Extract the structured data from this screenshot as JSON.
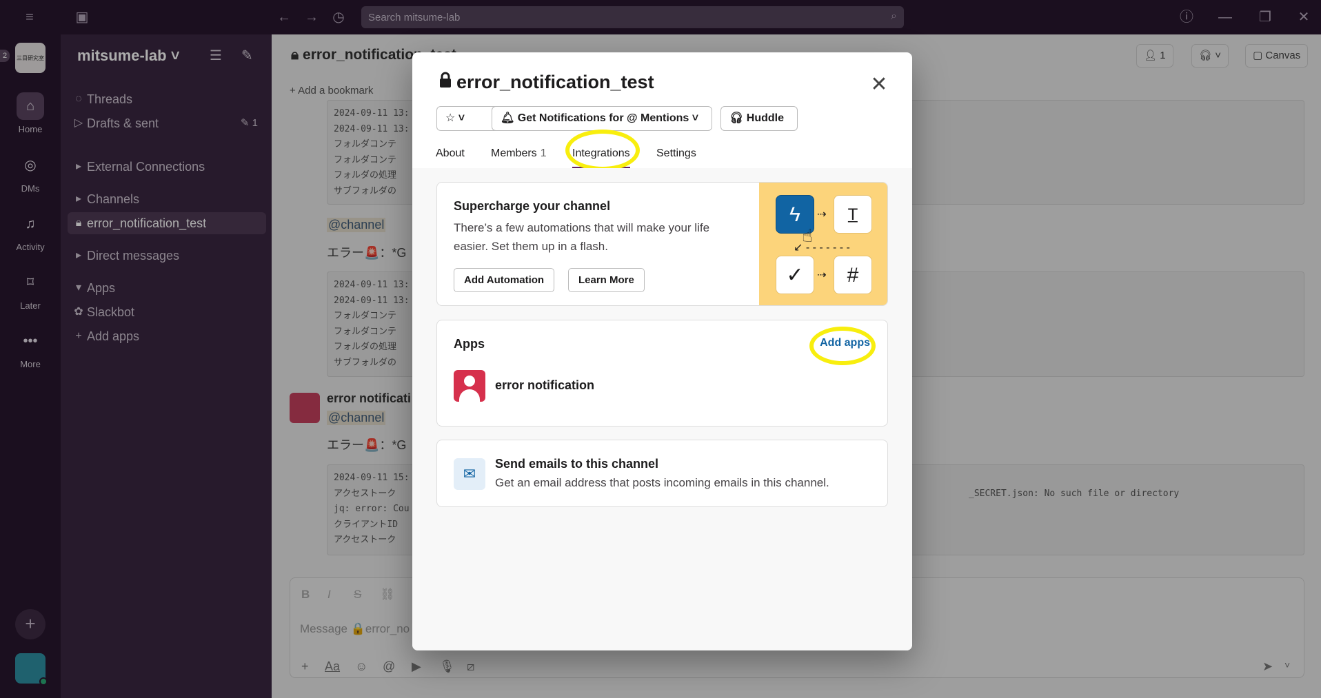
{
  "titlebar": {
    "search_placeholder": "Search mitsume-lab"
  },
  "rail": {
    "badge": "2",
    "workspace_logo_text": "三目研究室",
    "items": [
      {
        "label": "Home",
        "icon": "home-icon"
      },
      {
        "label": "DMs",
        "icon": "dm-icon"
      },
      {
        "label": "Activity",
        "icon": "bell-icon"
      },
      {
        "label": "Later",
        "icon": "bookmark-icon"
      },
      {
        "label": "More",
        "icon": "ellipsis-icon"
      }
    ]
  },
  "sidebar": {
    "workspace_name": "mitsume-lab",
    "threads": "Threads",
    "drafts": "Drafts & sent",
    "drafts_count": "1",
    "external": "External Connections",
    "channels": "Channels",
    "active_channel": "error_notification_test",
    "direct_messages": "Direct messages",
    "apps": "Apps",
    "slackbot": "Slackbot",
    "add_apps": "Add apps"
  },
  "main": {
    "channel_title": "error_notification_test",
    "bookmark": "Add a bookmark",
    "member_count": "1",
    "canvas": "Canvas",
    "code1": [
      "2024-09-11 13:",
      "2024-09-11 13:",
      "フォルダコンテ",
      "フォルダコンテ",
      "フォルダの処理",
      "サブフォルダの"
    ],
    "mention1": "@channel",
    "error1": "エラー🚨：*G",
    "code2": [
      "2024-09-11 13:",
      "2024-09-11 13:",
      "フォルダコンテ",
      "フォルダコンテ",
      "フォルダの処理",
      "サブフォルダの"
    ],
    "sender": "error notificati",
    "mention2": "@channel",
    "error2": "エラー🚨：*G",
    "code3": [
      "2024-09-11 15:",
      "アクセストーク",
      "jq: error: Cou",
      "クライアントID",
      "アクセストーク"
    ],
    "code3_tail": "_SECRET.json: No such file or directory",
    "composer_placeholder": "Message 🔒error_no"
  },
  "modal": {
    "title": "error_notification_test",
    "notif_button": "Get Notifications for @ Mentions",
    "huddle_button": "Huddle",
    "tabs": [
      {
        "label": "About",
        "count": ""
      },
      {
        "label": "Members",
        "count": "1"
      },
      {
        "label": "Integrations",
        "count": ""
      },
      {
        "label": "Settings",
        "count": ""
      }
    ],
    "active_tab": "Integrations",
    "supercharge": {
      "title": "Supercharge your channel",
      "line1": "There’s a few automations that will make your life",
      "line2": "easier. Set them up in a flash.",
      "add_automation": "Add Automation",
      "learn_more": "Learn More"
    },
    "apps": {
      "title": "Apps",
      "add_apps": "Add apps",
      "app_name": "error notification"
    },
    "email": {
      "title": "Send emails to this channel",
      "desc": "Get an email address that posts incoming emails in this channel."
    }
  },
  "colors": {
    "aubergine": "#3a2741",
    "highlight": "#f8ee0e",
    "link": "#1264a3",
    "art_bg": "#fcd47b"
  }
}
